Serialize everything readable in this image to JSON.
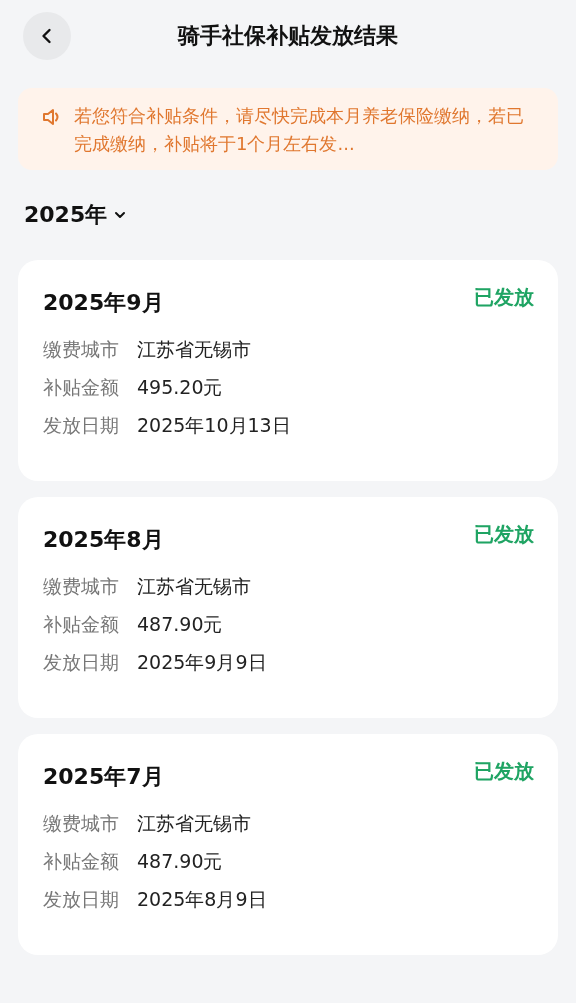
{
  "header": {
    "title": "骑手社保补贴发放结果"
  },
  "notice": {
    "text": "若您符合补贴条件，请尽快完成本月养老保险缴纳，若已完成缴纳，补贴将于1个月左右发..."
  },
  "year_selector": {
    "label": "2025年",
    "expanded": false
  },
  "records": [
    {
      "month": "2025年9月",
      "status": {
        "text": "已发放",
        "kind": "paid"
      },
      "fields": [
        {
          "label": "缴费城市",
          "value": "江苏省无锡市"
        },
        {
          "label": "补贴金额",
          "value": "495.20元"
        },
        {
          "label": "发放日期",
          "value": "2025年10月13日"
        }
      ]
    },
    {
      "month": "2025年8月",
      "status": {
        "text": "已发放",
        "kind": "paid"
      },
      "fields": [
        {
          "label": "缴费城市",
          "value": "江苏省无锡市"
        },
        {
          "label": "补贴金额",
          "value": "487.90元"
        },
        {
          "label": "发放日期",
          "value": "2025年9月9日"
        }
      ]
    },
    {
      "month": "2025年7月",
      "status": {
        "text": "已发放",
        "kind": "paid"
      },
      "fields": [
        {
          "label": "缴费城市",
          "value": "江苏省无锡市"
        },
        {
          "label": "补贴金额",
          "value": "487.90元"
        },
        {
          "label": "发放日期",
          "value": "2025年8月9日"
        }
      ]
    }
  ]
}
